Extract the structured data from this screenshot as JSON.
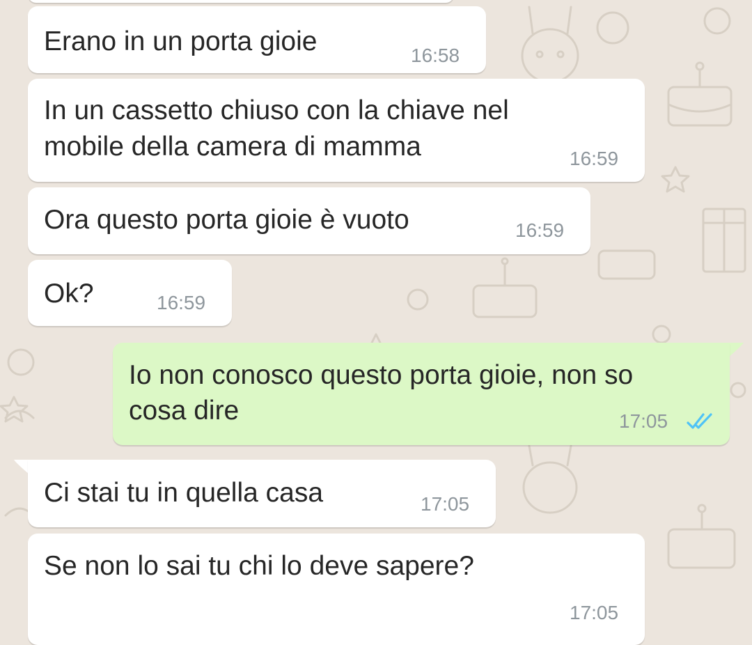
{
  "messages": [
    {
      "direction": "in",
      "text_lines": [
        "Erano in un porta gioie"
      ],
      "time": "16:58"
    },
    {
      "direction": "in",
      "text_lines": [
        "In un cassetto chiuso con la chiave nel",
        "mobile della camera di mamma"
      ],
      "time": "16:59"
    },
    {
      "direction": "in",
      "text_lines": [
        "Ora questo porta gioie è vuoto"
      ],
      "time": "16:59"
    },
    {
      "direction": "in",
      "text_lines": [
        "Ok?"
      ],
      "time": "16:59"
    },
    {
      "direction": "out",
      "text_lines": [
        "Io non conosco questo porta gioie, non so",
        "cosa dire"
      ],
      "time": "17:05",
      "status": "read"
    },
    {
      "direction": "in",
      "text_lines": [
        "Ci stai tu in quella casa"
      ],
      "time": "17:05"
    },
    {
      "direction": "in",
      "text_lines": [
        "Se non lo sai tu chi lo deve sapere?"
      ],
      "time": "17:05"
    }
  ],
  "colors": {
    "background": "#ECE5DD",
    "incoming_bubble": "#FFFFFF",
    "outgoing_bubble": "#DCF8C6",
    "text": "#262626",
    "time": "#8E969C",
    "read_ticks": "#4FC3F7"
  },
  "icons": {
    "read_receipt": "double-check-icon"
  }
}
